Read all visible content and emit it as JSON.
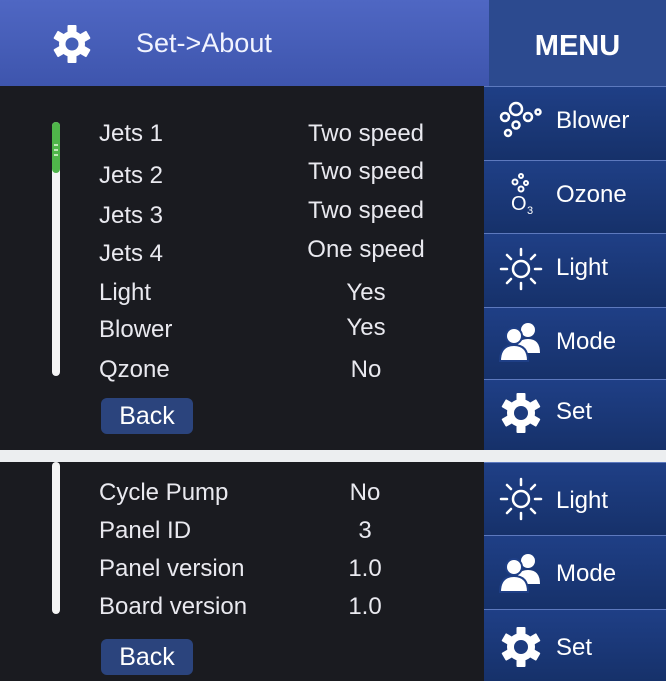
{
  "screen1": {
    "title": "Set->About",
    "menu_heading": "MENU",
    "scroll_progress": 0.2,
    "rows": [
      {
        "label": "Jets 1",
        "value": "Two speed"
      },
      {
        "label": "Jets 2",
        "value": "Two speed"
      },
      {
        "label": "Jets 3",
        "value": "Two speed"
      },
      {
        "label": "Jets 4",
        "value": "One speed"
      },
      {
        "label": "Light",
        "value": "Yes"
      },
      {
        "label": "Blower",
        "value": "Yes"
      },
      {
        "label": "Qzone",
        "value": "No"
      }
    ],
    "back_label": "Back",
    "side_menu": [
      {
        "label": "Blower",
        "icon": "bubbles-icon"
      },
      {
        "label": "Ozone",
        "icon": "ozone-icon"
      },
      {
        "label": "Light",
        "icon": "sun-icon"
      },
      {
        "label": "Mode",
        "icon": "people-icon"
      },
      {
        "label": "Set",
        "icon": "gear-icon"
      }
    ]
  },
  "screen2": {
    "rows": [
      {
        "label": "Cycle Pump",
        "value": "No"
      },
      {
        "label": "Panel ID",
        "value": "3"
      },
      {
        "label": "Panel version",
        "value": "1.0"
      },
      {
        "label": "Board version",
        "value": "1.0"
      }
    ],
    "back_label": "Back",
    "side_menu": [
      {
        "label": "Light",
        "icon": "sun-icon"
      },
      {
        "label": "Mode",
        "icon": "people-icon"
      },
      {
        "label": "Set",
        "icon": "gear-icon"
      }
    ]
  },
  "colors": {
    "title_bar": "#4560b8",
    "menu_panel": "#1f3f86",
    "screen_background": "#1a1b20",
    "scroll_thumb": "#4fb54a",
    "back_button": "#2b447d"
  }
}
